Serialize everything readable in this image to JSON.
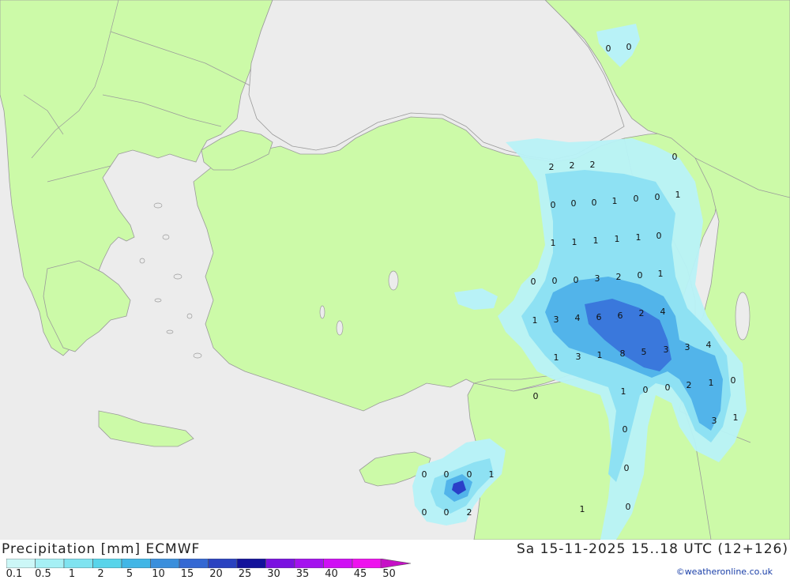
{
  "title": {
    "product": "Precipitation [mm] ECMWF",
    "valid_time": "Sa 15-11-2025 15..18 UTC (12+126)"
  },
  "credit": "©weatheronline.co.uk",
  "legend": {
    "ticks": [
      "0.1",
      "0.5",
      "1",
      "2",
      "5",
      "10",
      "15",
      "20",
      "25",
      "30",
      "35",
      "40",
      "45",
      "50"
    ],
    "colors": [
      "#ccf7f7",
      "#a6f0f5",
      "#7fe3f0",
      "#58d4ea",
      "#41b6e6",
      "#3a8fdc",
      "#3468d3",
      "#2a42c0",
      "#13129b",
      "#7a12e0",
      "#a412ee",
      "#cf10f4",
      "#ee12ee",
      "#c610c6"
    ]
  },
  "map": {
    "colors": {
      "land": "#ccfaa8",
      "sea": "#ececec",
      "border": "#9a9a9a",
      "precip_light": "#b8f2f7",
      "precip_mid": "#8ee1f3",
      "precip_heavy": "#52b4ea",
      "precip_max": "#3a78dc",
      "precip_core": "#2a3fc8"
    },
    "values": [
      {
        "v": "0"
      },
      {
        "v": "0"
      },
      {
        "v": "2"
      },
      {
        "v": "2"
      },
      {
        "v": "2"
      },
      {
        "v": "0"
      },
      {
        "v": "0"
      },
      {
        "v": "0"
      },
      {
        "v": "0"
      },
      {
        "v": "1"
      },
      {
        "v": "0"
      },
      {
        "v": "0"
      },
      {
        "v": "1"
      },
      {
        "v": "1"
      },
      {
        "v": "1"
      },
      {
        "v": "1"
      },
      {
        "v": "1"
      },
      {
        "v": "1"
      },
      {
        "v": "0"
      },
      {
        "v": "0"
      },
      {
        "v": "0"
      },
      {
        "v": "0"
      },
      {
        "v": "3"
      },
      {
        "v": "2"
      },
      {
        "v": "0"
      },
      {
        "v": "1"
      },
      {
        "v": "1"
      },
      {
        "v": "3"
      },
      {
        "v": "4"
      },
      {
        "v": "6"
      },
      {
        "v": "6"
      },
      {
        "v": "2"
      },
      {
        "v": "4"
      },
      {
        "v": "1"
      },
      {
        "v": "3"
      },
      {
        "v": "1"
      },
      {
        "v": "8"
      },
      {
        "v": "5"
      },
      {
        "v": "3"
      },
      {
        "v": "3"
      },
      {
        "v": "4"
      },
      {
        "v": "1"
      },
      {
        "v": "0"
      },
      {
        "v": "0"
      },
      {
        "v": "2"
      },
      {
        "v": "1"
      },
      {
        "v": "0"
      },
      {
        "v": "0"
      },
      {
        "v": "3"
      },
      {
        "v": "1"
      },
      {
        "v": "0"
      },
      {
        "v": "0"
      },
      {
        "v": "0"
      },
      {
        "v": "0"
      },
      {
        "v": "0"
      },
      {
        "v": "1"
      },
      {
        "v": "0"
      },
      {
        "v": "0"
      },
      {
        "v": "2"
      },
      {
        "v": "1"
      },
      {
        "v": "0"
      },
      {
        "v": "1"
      }
    ]
  }
}
